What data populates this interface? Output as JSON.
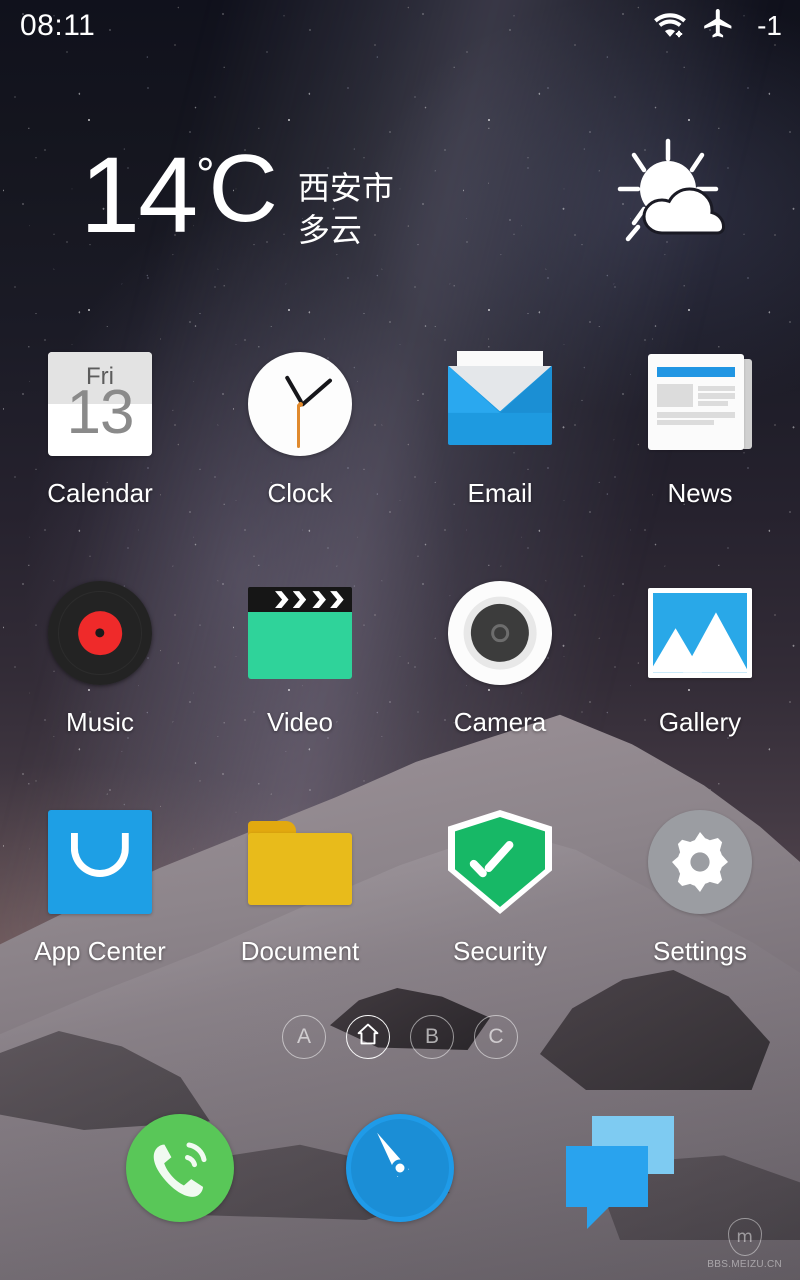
{
  "statusbar": {
    "time": "08:11",
    "wifi_icon": "wifi-icon",
    "airplane_icon": "airplane-mode-icon",
    "battery_text": "-1"
  },
  "weather_widget": {
    "temperature": "14",
    "degree_symbol": "°",
    "unit": "C",
    "city": "西安市",
    "condition": "多云",
    "icon": "sun-behind-cloud-icon"
  },
  "app_grid": {
    "rows": 3,
    "columns": 4,
    "apps": [
      {
        "label": "Calendar",
        "icon": "calendar-icon",
        "day_of_week": "Fri",
        "day_number": "13"
      },
      {
        "label": "Clock",
        "icon": "clock-icon"
      },
      {
        "label": "Email",
        "icon": "email-envelope-icon"
      },
      {
        "label": "News",
        "icon": "newspaper-icon"
      },
      {
        "label": "Music",
        "icon": "vinyl-record-icon"
      },
      {
        "label": "Video",
        "icon": "clapperboard-icon"
      },
      {
        "label": "Camera",
        "icon": "camera-lens-icon"
      },
      {
        "label": "Gallery",
        "icon": "photo-mountains-icon"
      },
      {
        "label": "App Center",
        "icon": "shopping-bag-icon"
      },
      {
        "label": "Document",
        "icon": "folder-icon"
      },
      {
        "label": "Security",
        "icon": "shield-check-icon"
      },
      {
        "label": "Settings",
        "icon": "gear-icon"
      }
    ]
  },
  "page_indicators": {
    "items": [
      {
        "label": "A",
        "icon": "letter-a",
        "active": false
      },
      {
        "label": "",
        "icon": "home-icon",
        "active": true
      },
      {
        "label": "B",
        "icon": "letter-b",
        "active": false
      },
      {
        "label": "C",
        "icon": "letter-c",
        "active": false
      }
    ]
  },
  "dock": {
    "items": [
      {
        "name": "Phone",
        "icon": "phone-handset-icon"
      },
      {
        "name": "Browser",
        "icon": "compass-needle-icon"
      },
      {
        "name": "Messages",
        "icon": "chat-bubbles-icon"
      }
    ]
  },
  "watermark": {
    "logo": "meizu-m-logo",
    "logo_letter": "m",
    "text": "BBS.MEIZU.CN"
  },
  "colors": {
    "email_blue": "#1e9ae0",
    "news_blue": "#2196e3",
    "video_green": "#2fd39a",
    "music_red": "#ef2a2a",
    "gallery_blue": "#29a8e8",
    "appcenter_blue": "#1e9fe5",
    "folder_yellow": "#e8bb1b",
    "security_green": "#17b866",
    "settings_gray": "#9b9da2",
    "phone_green": "#59c758",
    "browser_blue": "#1f9be8",
    "message_blue": "#29a3ee",
    "message_blue_light": "#7ecbf2",
    "second_hand_orange": "#e08a2e",
    "label_white": "#ffffff"
  }
}
